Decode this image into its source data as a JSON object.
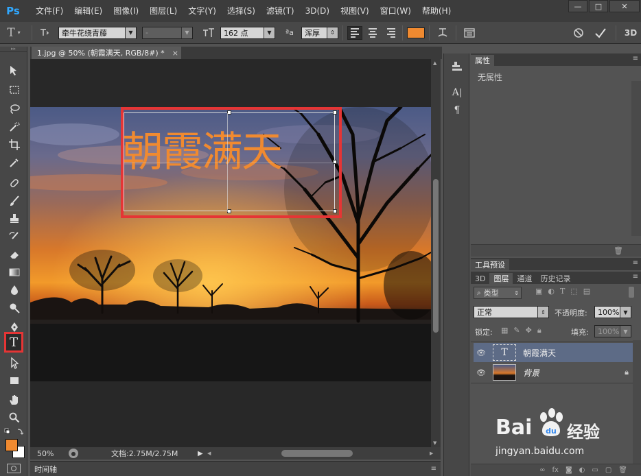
{
  "app": {
    "logo": "Ps"
  },
  "menu": [
    "文件(F)",
    "编辑(E)",
    "图像(I)",
    "图层(L)",
    "文字(Y)",
    "选择(S)",
    "滤镜(T)",
    "3D(D)",
    "视图(V)",
    "窗口(W)",
    "帮助(H)"
  ],
  "window_controls": [
    "—",
    "□",
    "✕"
  ],
  "options_bar": {
    "font_family": "牵牛花绕青藤",
    "font_style": "-",
    "font_size": "162 点",
    "aa_label": "ªa",
    "antialias": "浑厚",
    "text_color": "#f08a30",
    "three_d": "3D"
  },
  "document": {
    "tab_title": "1.jpg @ 50% (朝霞满天, RGB/8#) *",
    "tab_close": "×",
    "text_layer_content": "朝霞满天",
    "zoom": "50%",
    "doc_info": "文档:2.75M/2.75M",
    "timeline_label": "时间轴",
    "text_color": "#f08a30"
  },
  "properties_panel": {
    "tab": "属性",
    "empty_message": "无属性"
  },
  "tool_presets": {
    "tab": "工具预设"
  },
  "layers_panel": {
    "tabs": [
      "3D",
      "图层",
      "通道",
      "历史记录"
    ],
    "active_tab": "图层",
    "filter_label": "类型",
    "blend_mode": "正常",
    "opacity_label": "不透明度:",
    "opacity_value": "100%",
    "lock_label": "锁定:",
    "fill_label": "填充:",
    "fill_value": "100%",
    "layers": [
      {
        "name": "朝霞满天",
        "type": "text",
        "selected": true
      },
      {
        "name": "背景",
        "type": "image",
        "locked": true
      }
    ]
  },
  "watermark": {
    "brand": "Bai",
    "brand_cn": "经验",
    "url": "jingyan.baidu.com"
  },
  "colors": {
    "foreground": "#f08a30",
    "background": "#ffffff",
    "highlight": "#e53535"
  }
}
